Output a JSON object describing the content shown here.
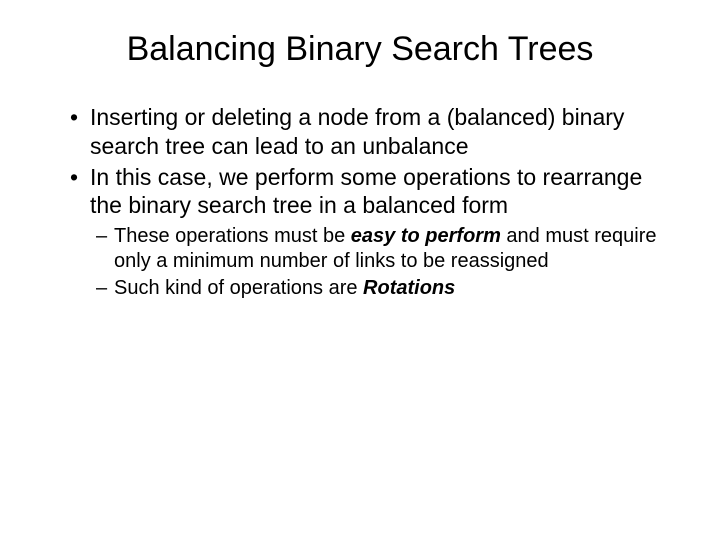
{
  "slide": {
    "title": "Balancing Binary Search Trees",
    "bullets": [
      {
        "text": "Inserting or deleting a node from a (balanced) binary search tree can lead to an unbalance"
      },
      {
        "text": "In this case, we perform some operations to rearrange the binary search tree in a balanced form"
      }
    ],
    "sub1_a": "These operations must be ",
    "sub1_b": "easy to perform",
    "sub1_c": " and must require only a minimum number of links to be reassigned",
    "sub2_a": "Such kind of operations are ",
    "sub2_b": "Rotations"
  }
}
